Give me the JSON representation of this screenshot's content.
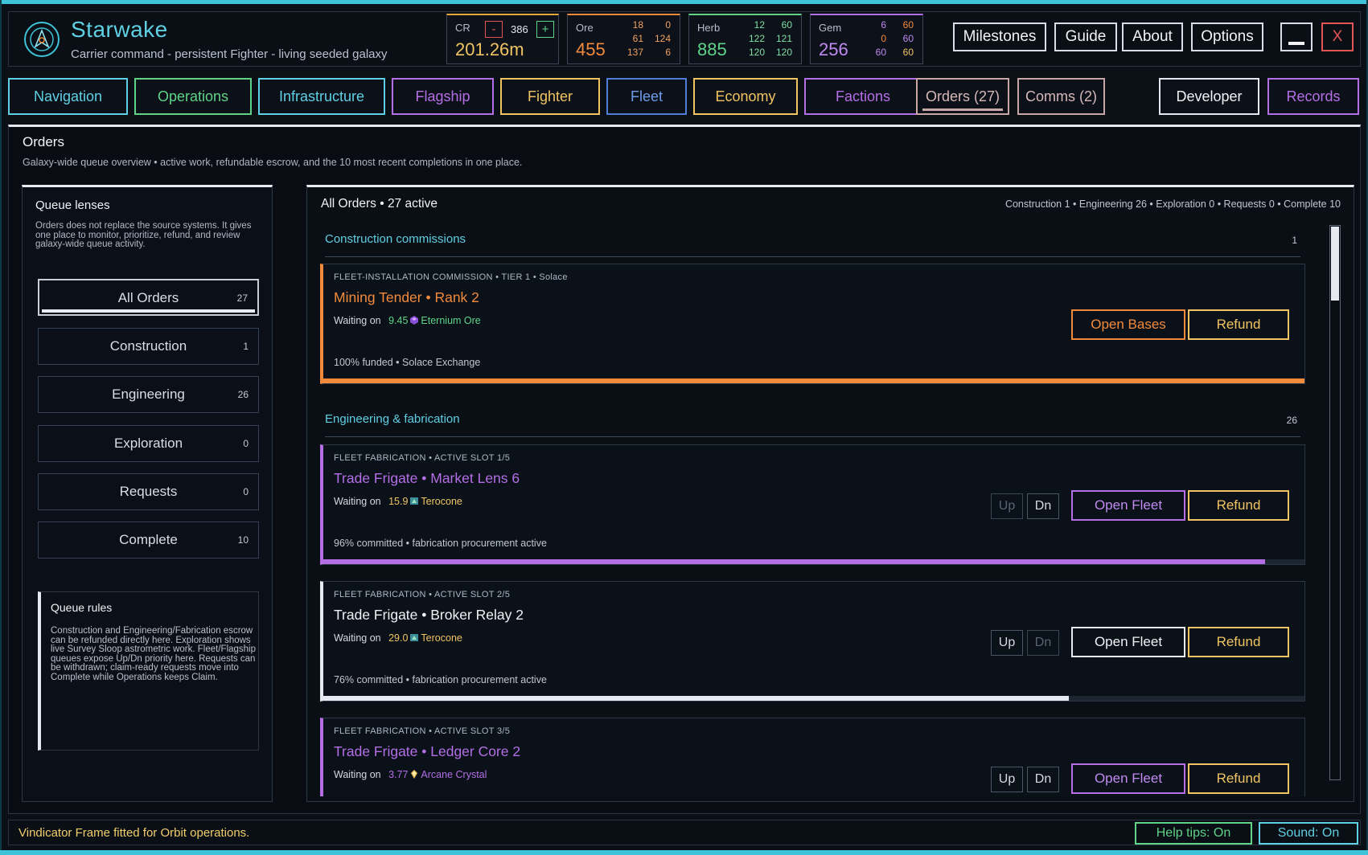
{
  "app": {
    "title": "Starwake",
    "subtitle": "Carrier command - persistent Fighter - living seeded galaxy",
    "logo_icon": "star-compass-icon"
  },
  "resources": {
    "cr": {
      "label": "CR",
      "minus": "-",
      "step": "386",
      "plus": "+",
      "value": "201.26m"
    },
    "ore": {
      "label": "Ore",
      "value": "455",
      "a1": "18",
      "a2": "0",
      "b1": "61",
      "b2": "124",
      "c1": "137",
      "c2": "6"
    },
    "herb": {
      "label": "Herb",
      "value": "885",
      "a1": "12",
      "a2": "60",
      "b1": "122",
      "b2": "121",
      "c1": "120",
      "c2": "120"
    },
    "gem": {
      "label": "Gem",
      "value": "256",
      "a1": "6",
      "a2": "60",
      "b1": "0",
      "b2": "60",
      "c1": "60",
      "c2": "60"
    }
  },
  "header_buttons": {
    "milestones": "Milestones",
    "guide": "Guide",
    "about": "About",
    "options": "Options",
    "minimize": "",
    "close": "X"
  },
  "tabs": [
    {
      "label": "Navigation"
    },
    {
      "label": "Operations"
    },
    {
      "label": "Infrastructure"
    },
    {
      "label": "Flagship"
    },
    {
      "label": "Fighter"
    },
    {
      "label": "Fleet"
    },
    {
      "label": "Economy"
    },
    {
      "label": "Factions"
    },
    {
      "label": "Orders (27)"
    },
    {
      "label": "Comms (2)"
    },
    {
      "label": "Developer"
    },
    {
      "label": "Records"
    }
  ],
  "page": {
    "title": "Orders",
    "subtitle": "Galaxy-wide queue overview • active work, refundable escrow, and the 10 most recent completions in one place."
  },
  "lenses": {
    "title": "Queue lenses",
    "description": "Orders does not replace the source systems. It gives one place to monitor, prioritize, refund, and review galaxy-wide queue activity.",
    "items": [
      {
        "label": "All Orders",
        "count": "27"
      },
      {
        "label": "Construction",
        "count": "1"
      },
      {
        "label": "Engineering",
        "count": "26"
      },
      {
        "label": "Exploration",
        "count": "0"
      },
      {
        "label": "Requests",
        "count": "0"
      },
      {
        "label": "Complete",
        "count": "10"
      }
    ],
    "rules_title": "Queue rules",
    "rules_text": "Construction and Engineering/Fabrication escrow can be refunded directly here. Exploration shows live Survey Sloop astrometric work. Fleet/Flagship queues expose Up/Dn priority here. Requests can be withdrawn; claim-ready requests move into Complete while Operations keeps Claim."
  },
  "orders": {
    "title": "All Orders  •  27 active",
    "stats": "Construction 1  •  Engineering 26  •  Exploration 0  •  Requests 0  •  Complete 10",
    "sections": [
      {
        "label": "Construction commissions",
        "count": "1"
      },
      {
        "label": "Engineering & fabrication",
        "count": "26"
      }
    ],
    "cards": [
      {
        "kind": "FLEET-INSTALLATION COMMISSION • TIER 1 • Solace",
        "name": "Mining Tender  •  Rank 2",
        "waiting_label": "Waiting on",
        "amount": "9.45",
        "resource": "Eternium Ore",
        "resource_icon": "eternium-ore-icon",
        "status": "100% funded  •  Solace Exchange",
        "progress": 1.0,
        "open_label": "Open Bases",
        "refund_label": "Refund"
      },
      {
        "kind": "FLEET FABRICATION • ACTIVE SLOT 1/5",
        "name": "Trade Frigate  •  Market Lens 6",
        "waiting_label": "Waiting on",
        "amount": "15.9",
        "resource": "Terocone",
        "resource_icon": "terocone-icon",
        "status": "96% committed  •  fabrication procurement active",
        "progress": 0.96,
        "up_label": "Up",
        "dn_label": "Dn",
        "open_label": "Open Fleet",
        "refund_label": "Refund"
      },
      {
        "kind": "FLEET FABRICATION • ACTIVE SLOT 2/5",
        "name": "Trade Frigate  •  Broker Relay 2",
        "waiting_label": "Waiting on",
        "amount": "29.0",
        "resource": "Terocone",
        "resource_icon": "terocone-icon",
        "status": "76% committed  •  fabrication procurement active",
        "progress": 0.76,
        "up_label": "Up",
        "dn_label": "Dn",
        "open_label": "Open Fleet",
        "refund_label": "Refund"
      },
      {
        "kind": "FLEET FABRICATION • ACTIVE SLOT 3/5",
        "name": "Trade Frigate  •  Ledger Core 2",
        "waiting_label": "Waiting on",
        "amount": "3.77",
        "resource": "Arcane Crystal",
        "resource_icon": "arcane-crystal-icon",
        "up_label": "Up",
        "dn_label": "Dn",
        "open_label": "Open Fleet",
        "refund_label": "Refund"
      }
    ]
  },
  "footer": {
    "message": "Vindicator Frame fitted for Orbit operations.",
    "help_tips": "Help tips: On",
    "sound": "Sound: On"
  },
  "colors": {
    "cyan": "#5fd0e3",
    "orange": "#f28a3c",
    "purple": "#b46ee6",
    "gold": "#f1c462",
    "green": "#5fd488",
    "white": "#e6eaf0"
  }
}
